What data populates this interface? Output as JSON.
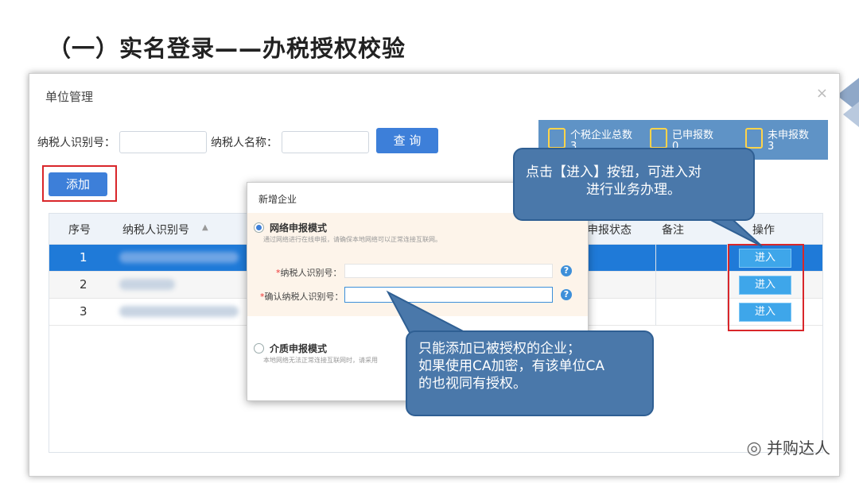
{
  "slide": {
    "title": "（一）实名登录——办税授权校验"
  },
  "window": {
    "title": "单位管理",
    "close": "×"
  },
  "search": {
    "taxpayer_id_label": "纳税人识别号：",
    "taxpayer_id_value": "",
    "taxpayer_name_label": "纳税人名称：",
    "taxpayer_name_value": "",
    "query_button": "查 询"
  },
  "stats": [
    {
      "label": "个税企业总数",
      "value": "3",
      "icon": "users-icon"
    },
    {
      "label": "已申报数",
      "value": "0",
      "icon": "document-icon"
    },
    {
      "label": "未申报数",
      "value": "3",
      "icon": "document-icon"
    }
  ],
  "toolbar": {
    "add_button": "添加"
  },
  "table": {
    "headers": {
      "no": "序号",
      "taxpayer_id": "纳税人识别号",
      "sort": "▲",
      "status": "申报状态",
      "remark": "备注",
      "action": "操作"
    },
    "rows": [
      {
        "no": "1",
        "action": "进入"
      },
      {
        "no": "2",
        "action": "进入"
      },
      {
        "no": "3",
        "action": "进入"
      }
    ]
  },
  "dialog": {
    "title": "新增企业",
    "close": "×",
    "network_mode": {
      "title": "网络申报模式",
      "desc": "通过网络进行在线申报，请确保本地网络可以正常连接互联网。",
      "field1_label": "纳税人识别号：",
      "field2_label": "确认纳税人识别号：",
      "help": "?"
    },
    "media_mode": {
      "title": "介质申报模式",
      "desc": "本地网络无法正常连接互联网时，请采用"
    }
  },
  "callouts": {
    "enter": [
      "点击【进入】按钮，可进入对",
      "进行业务办理。"
    ],
    "add": [
      "只能添加已被授权的企业；",
      "如果使用CA加密，有该单位CA",
      "的也视同有授权。"
    ]
  },
  "watermark": "并购达人"
}
